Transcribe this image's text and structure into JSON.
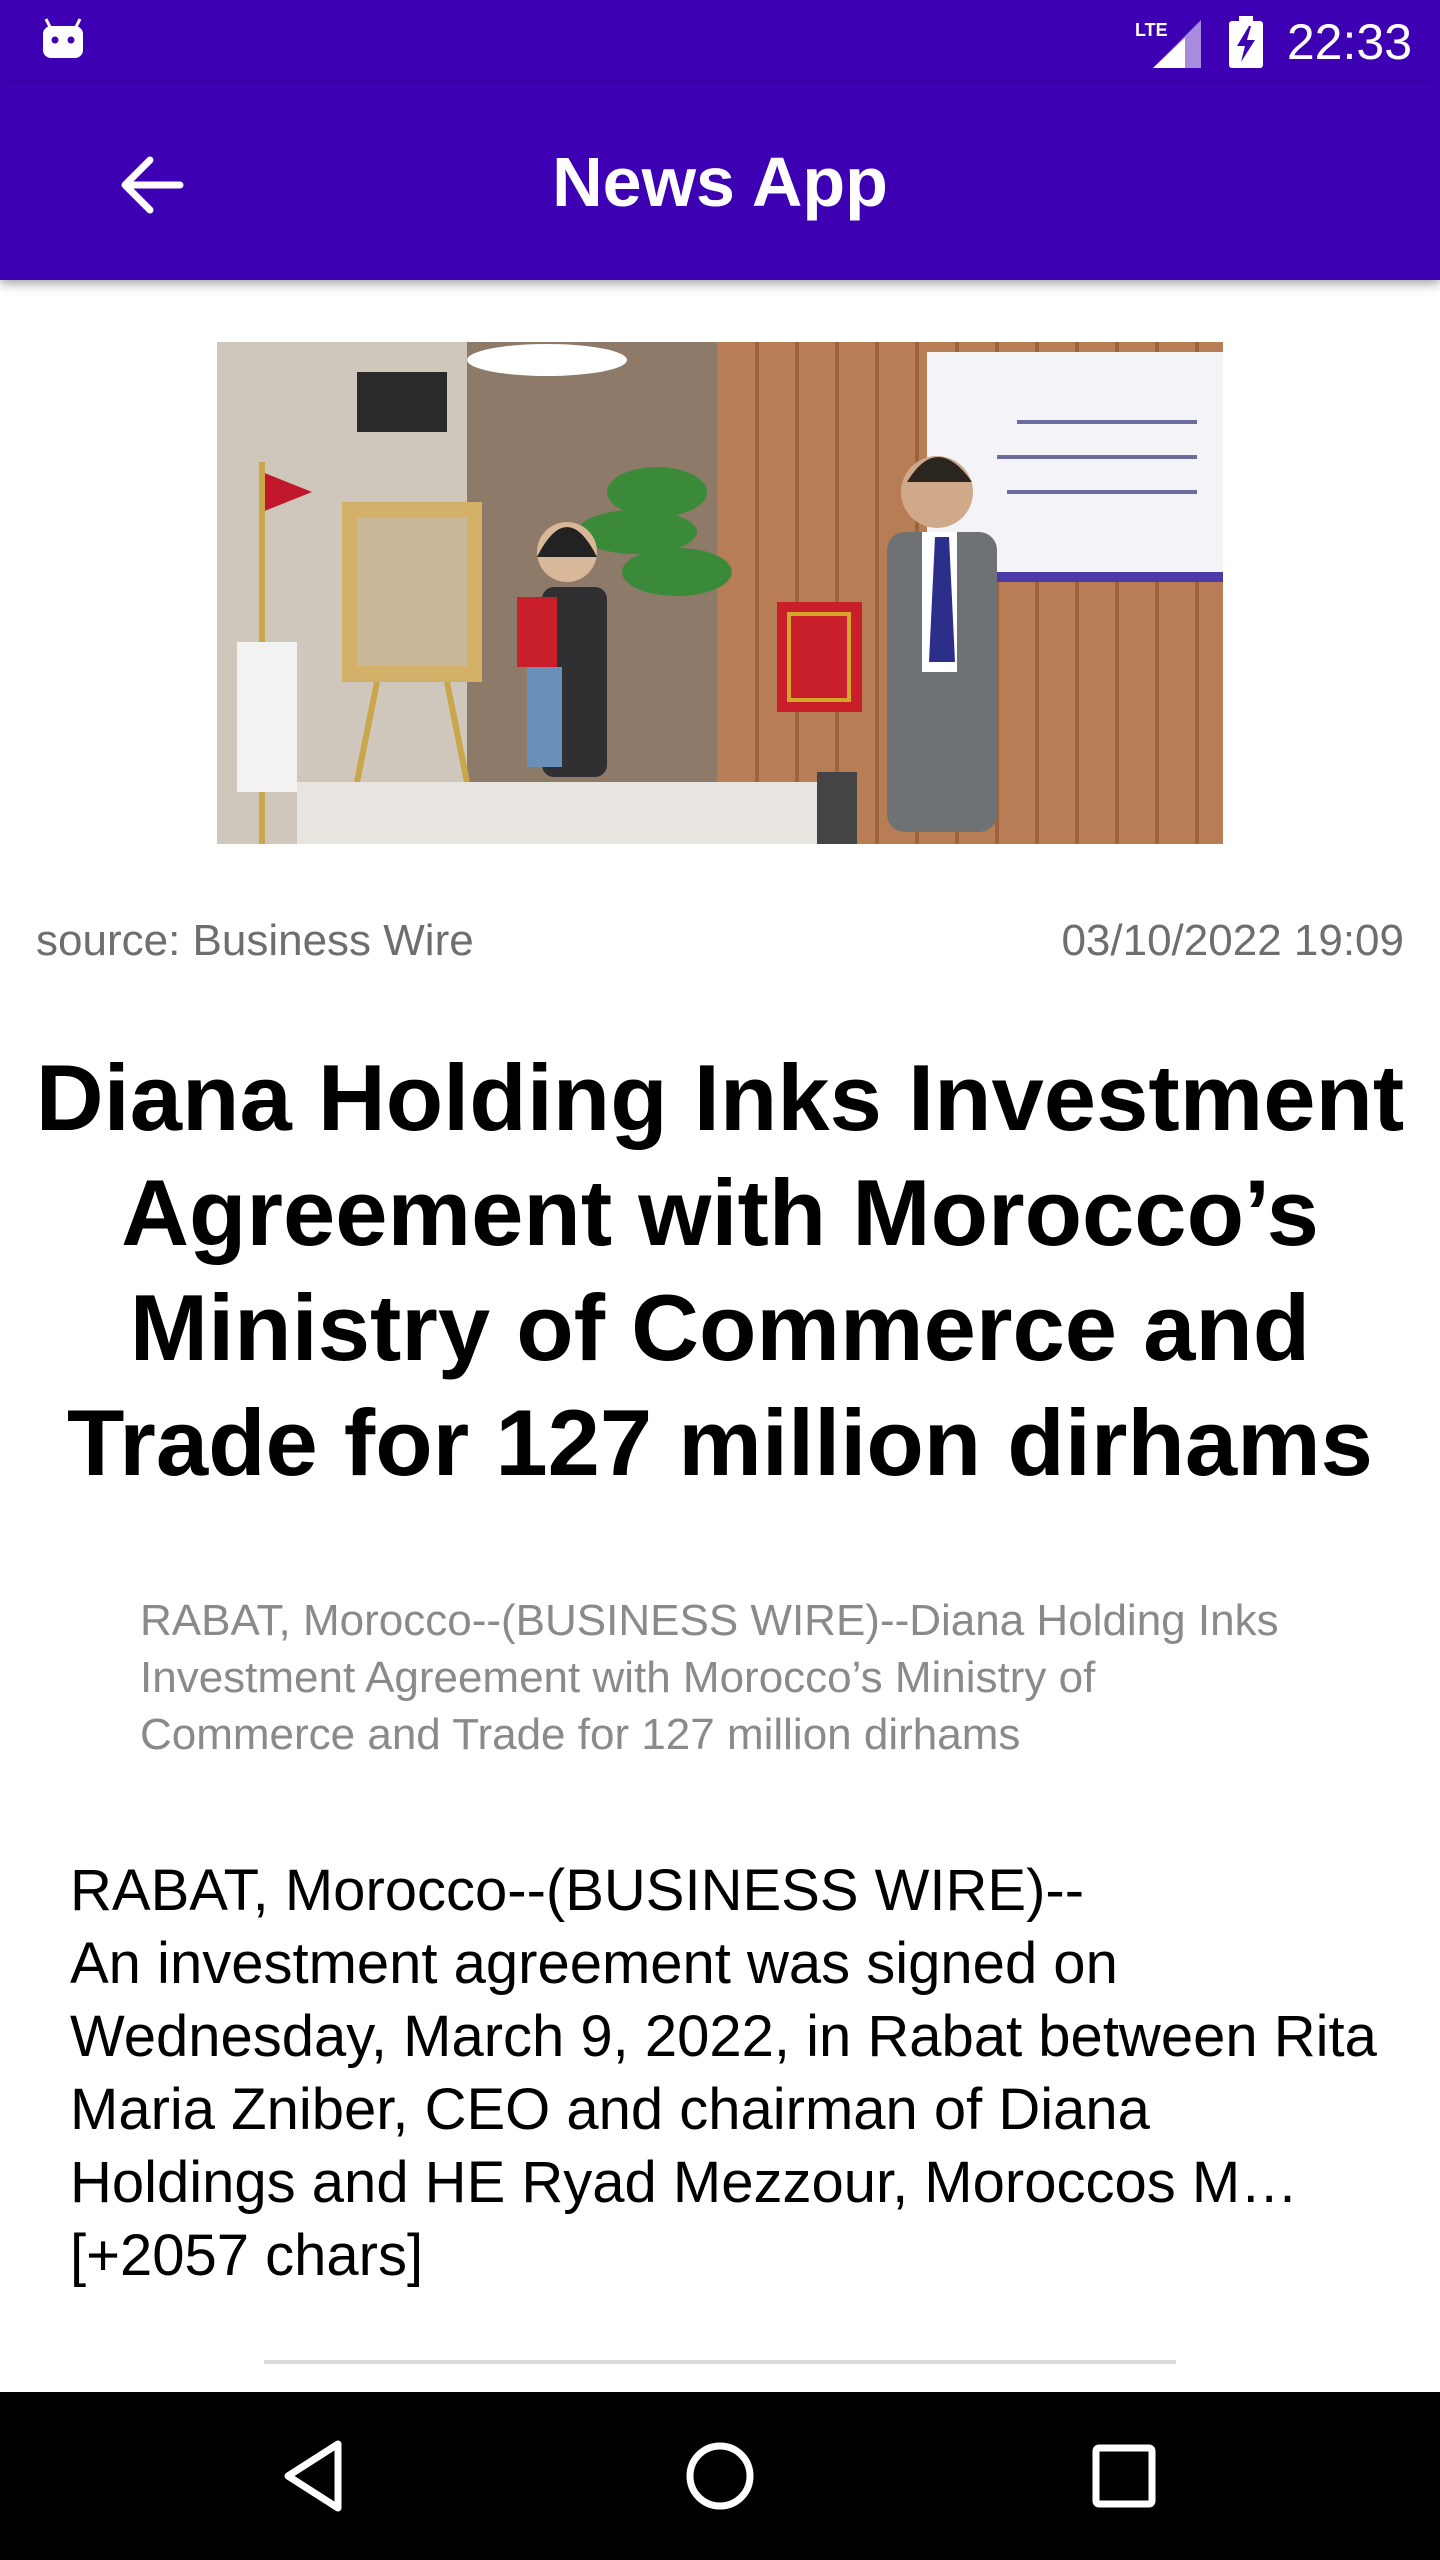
{
  "status_bar": {
    "time": "22:33",
    "network_label": "LTE",
    "icons": [
      "android-notification-icon",
      "lte-signal-icon",
      "battery-charging-icon"
    ]
  },
  "app_bar": {
    "title": "News App",
    "back_icon": "arrow-left-icon"
  },
  "article": {
    "image_alt": "Two people holding red folders at an agreement signing ceremony",
    "source": "source: Business Wire",
    "date": "03/10/2022 19:09",
    "headline": "Diana Holding Inks Investment Agreement with Morocco’s Ministry of Commerce and Trade for 127 million dirhams",
    "summary": "RABAT, Morocco--(BUSINESS WIRE)--Diana Holding Inks Investment Agreement with Morocco’s Ministry of Commerce and Trade for 127 million dirhams",
    "body": "RABAT, Morocco--(BUSINESS WIRE)--\nAn investment agreement was signed on Wednesday, March 9, 2022, in Rabat between Rita Maria Zniber, CEO and chairman of Diana Holdings and HE Ryad Mezzour, Moroccos M… [+2057 chars]"
  },
  "nav_bar": {
    "back_icon": "triangle-back-icon",
    "home_icon": "circle-home-icon",
    "recents_icon": "square-recents-icon"
  },
  "colors": {
    "primary": "#3d00b3",
    "secondary_text": "#6e6e6e",
    "summary_text": "#8a8a8a"
  }
}
